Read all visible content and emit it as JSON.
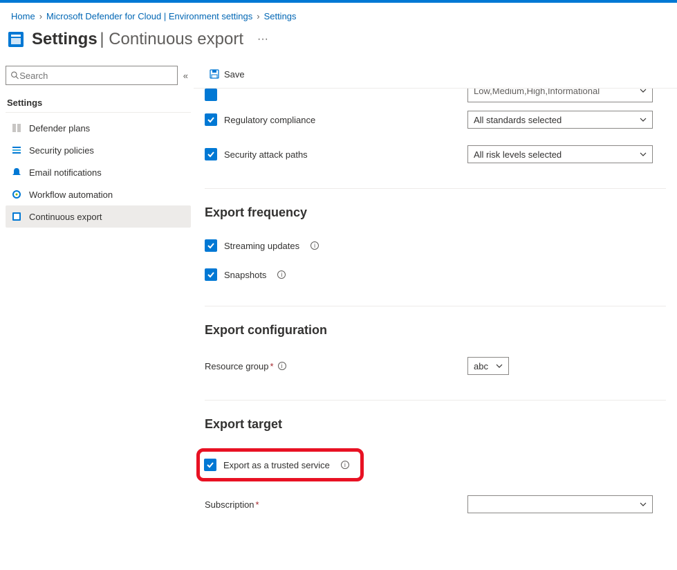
{
  "breadcrumb": {
    "home": "Home",
    "item1": "Microsoft Defender for Cloud | Environment settings",
    "item2": "Settings"
  },
  "header": {
    "title": "Settings",
    "subtitle": "Continuous export"
  },
  "sidebar": {
    "search_placeholder": "Search",
    "section_label": "Settings",
    "items": [
      {
        "label": "Defender plans"
      },
      {
        "label": "Security policies"
      },
      {
        "label": "Email notifications"
      },
      {
        "label": "Workflow automation"
      },
      {
        "label": "Continuous export"
      }
    ]
  },
  "toolbar": {
    "save_label": "Save"
  },
  "main": {
    "cutoff_dropdown": "Low,Medium,High,Informational",
    "checks": {
      "regulatory": "Regulatory compliance",
      "attack_paths": "Security attack paths"
    },
    "dropdowns": {
      "standards": "All standards selected",
      "risk_levels": "All risk levels selected"
    },
    "freq": {
      "title": "Export frequency",
      "streaming": "Streaming updates",
      "snapshots": "Snapshots"
    },
    "config": {
      "title": "Export configuration",
      "resource_group": "Resource group",
      "resource_group_value": "abc"
    },
    "target": {
      "title": "Export target",
      "trusted": "Export as a trusted service",
      "subscription": "Subscription"
    }
  }
}
